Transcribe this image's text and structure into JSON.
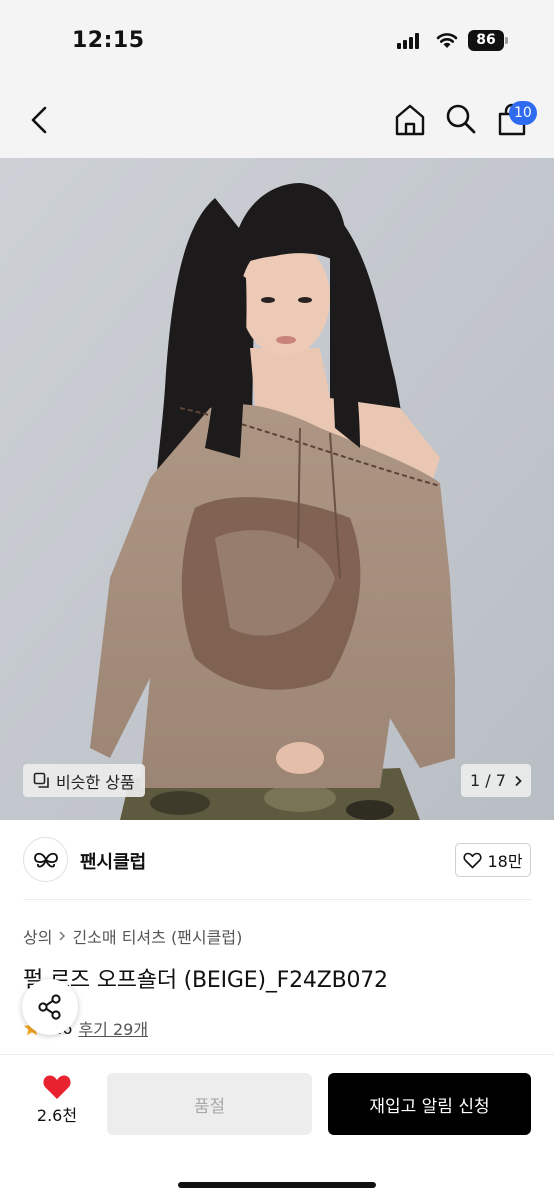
{
  "status_bar": {
    "time": "12:15",
    "battery": "86"
  },
  "nav": {
    "cart_count": "10"
  },
  "hero": {
    "similar_label": "비슷한 상품",
    "counter": "1 / 7"
  },
  "brand": {
    "name": "팬시클럽",
    "likes": "18만"
  },
  "breadcrumb": {
    "category": "상의",
    "subcategory": "긴소매 티셔츠 (팬시클럽)"
  },
  "product": {
    "title": "펄 로즈 오프숄더 (BEIGE)_F24ZB072",
    "rating": "4.6",
    "reviews": "후기 29개"
  },
  "bottom_bar": {
    "wish_count": "2.6천",
    "soldout_label": "품절",
    "restock_label": "재입고 알림 신청"
  },
  "colors": {
    "accent_blue": "#2f6bf0",
    "heart_red": "#e8232f",
    "star": "#f5a623"
  }
}
